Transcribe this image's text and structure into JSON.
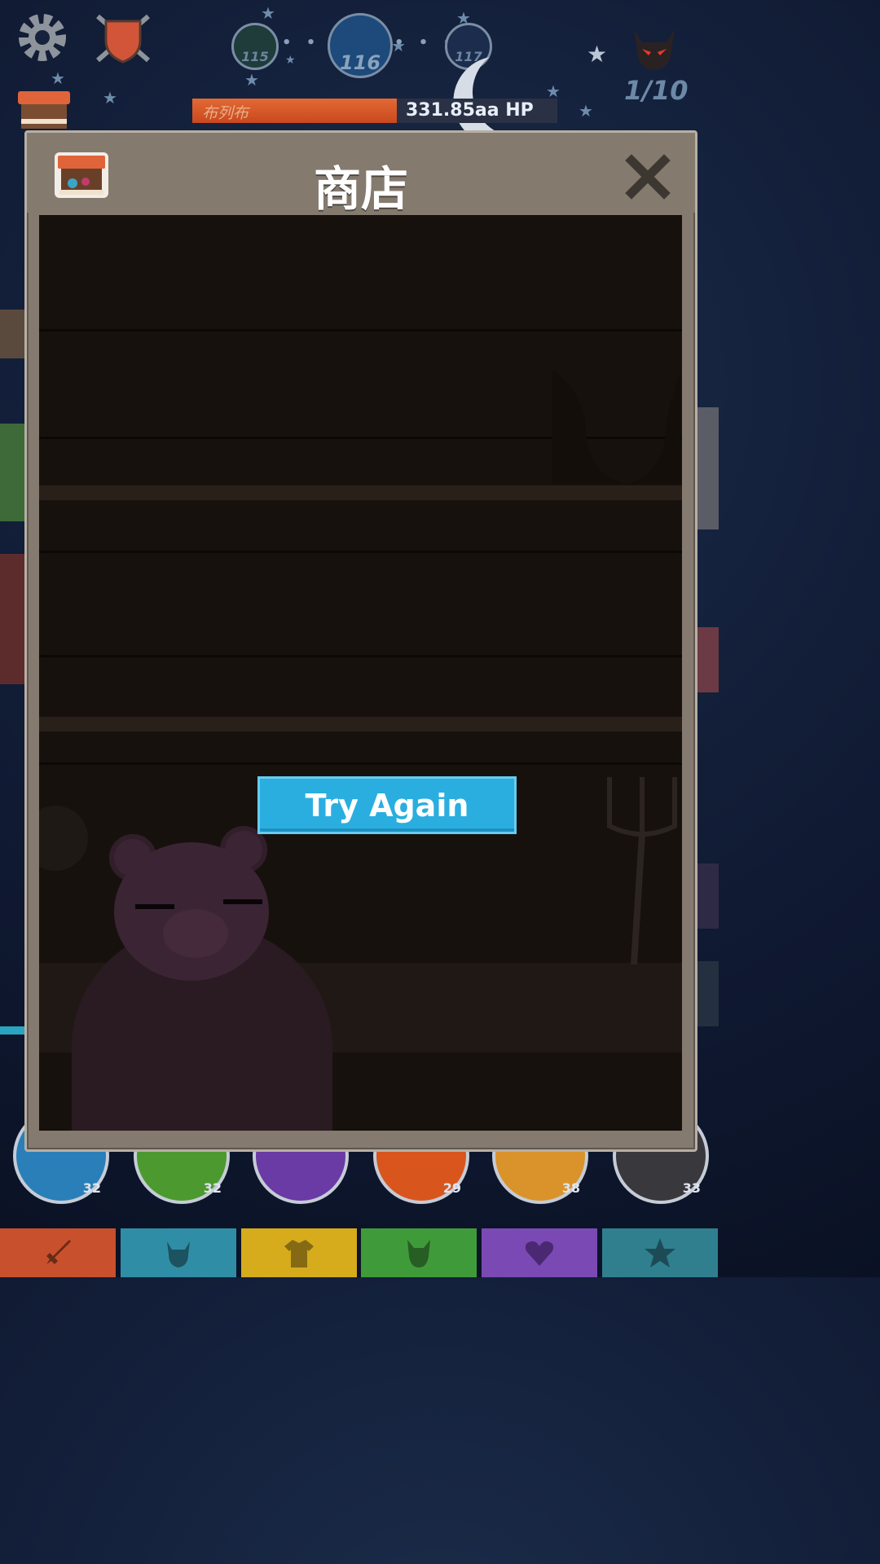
{
  "hud": {
    "stages": [
      {
        "label": "115",
        "state": "previous"
      },
      {
        "label": "116",
        "state": "current"
      },
      {
        "label": "117",
        "state": "next"
      }
    ],
    "stage_separator": "• • •",
    "boss": {
      "name": "布列布",
      "hp": "331.85aa HP",
      "hp_fraction": 0.56
    },
    "wave": "1/10"
  },
  "modal": {
    "title": "商店",
    "action_button": "Try Again"
  },
  "skill_circles": [
    {
      "level": "32",
      "color": "#2a7fb8"
    },
    {
      "level": "32",
      "color": "#4c9a2f"
    },
    {
      "level": "",
      "color": "#6a3aa5"
    },
    {
      "level": "29",
      "color": "#d8561d"
    },
    {
      "level": "38",
      "color": "#d9932a"
    },
    {
      "level": "33",
      "color": "#39383d"
    }
  ],
  "tabs": [
    {
      "name": "sword",
      "color": "#c8502c"
    },
    {
      "name": "helmet",
      "color": "#2f8ea6"
    },
    {
      "name": "shirt",
      "color": "#d6ab1c"
    },
    {
      "name": "pet",
      "color": "#3f9b39"
    },
    {
      "name": "heart",
      "color": "#7a49b4"
    },
    {
      "name": "star",
      "color": "#2f7f8f"
    }
  ]
}
